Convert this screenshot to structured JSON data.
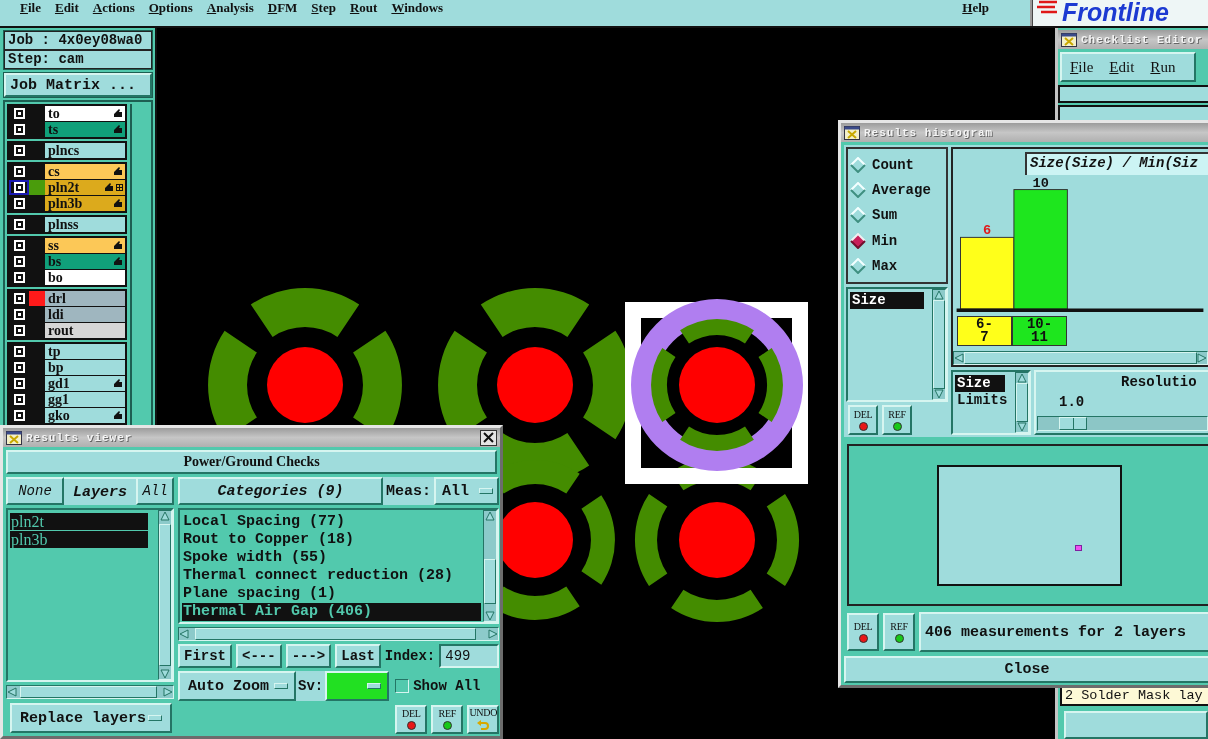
{
  "menu_bar": {
    "items": [
      "File",
      "Edit",
      "Actions",
      "Options",
      "Analysis",
      "DFM",
      "Step",
      "Rout",
      "Windows"
    ],
    "help": "Help",
    "logo": "Frontline"
  },
  "job_panel": {
    "job": "Job : 4x0ey08wa0",
    "step": "Step: cam",
    "matrix_button": "Job Matrix ..."
  },
  "layer_groups": [
    {
      "layers": [
        {
          "name": "to",
          "color": "#ffffff",
          "flagged": true,
          "grid_mark": false,
          "selected": false
        },
        {
          "name": "ts",
          "color": "#10a07a",
          "flagged": true,
          "grid_mark": false,
          "selected": false
        }
      ]
    },
    {
      "layers": [
        {
          "name": "plncs",
          "color": "#9fdcdc",
          "flagged": false,
          "grid_mark": false,
          "selected": false
        }
      ]
    },
    {
      "layers": [
        {
          "name": "cs",
          "color": "#fcc857",
          "flagged": true,
          "grid_mark": false,
          "selected": false
        },
        {
          "name": "pln2t",
          "color": "#dcaa1c",
          "swatch": {
            "color": "#4a9c0c"
          },
          "flagged": true,
          "grid_mark": true,
          "selected": true
        },
        {
          "name": "pln3b",
          "color": "#dcaa1c",
          "flagged": true,
          "grid_mark": false,
          "selected": false
        }
      ]
    },
    {
      "layers": [
        {
          "name": "plnss",
          "color": "#9fdcdc",
          "flagged": false,
          "grid_mark": false,
          "selected": false
        }
      ]
    },
    {
      "layers": [
        {
          "name": "ss",
          "color": "#fcc857",
          "flagged": true,
          "grid_mark": false,
          "selected": false
        },
        {
          "name": "bs",
          "color": "#10a07a",
          "flagged": true,
          "grid_mark": false,
          "selected": false
        },
        {
          "name": "bo",
          "color": "#ffffff",
          "flagged": false,
          "grid_mark": false,
          "selected": false
        }
      ]
    },
    {
      "layers": [
        {
          "name": "drl",
          "color": "#9fb6bf",
          "swatch": {
            "color": "#ff1a1a"
          },
          "flagged": false,
          "grid_mark": false,
          "selected": false
        },
        {
          "name": "ldi",
          "color": "#9fb6bf",
          "flagged": false,
          "grid_mark": false,
          "selected": false
        },
        {
          "name": "rout",
          "color": "#d6d6d6",
          "flagged": false,
          "grid_mark": false,
          "selected": false
        }
      ]
    },
    {
      "layers": [
        {
          "name": "tp",
          "color": "#9fdcdc",
          "flagged": false,
          "grid_mark": false,
          "selected": false
        },
        {
          "name": "bp",
          "color": "#9fdcdc",
          "flagged": false,
          "grid_mark": false,
          "selected": false
        },
        {
          "name": "gd1",
          "color": "#9fdcdc",
          "flagged": true,
          "grid_mark": false,
          "selected": false
        },
        {
          "name": "gg1",
          "color": "#9fdcdc",
          "flagged": false,
          "grid_mark": false,
          "selected": false
        },
        {
          "name": "gko",
          "color": "#9fdcdc",
          "flagged": true,
          "grid_mark": false,
          "selected": false
        }
      ]
    }
  ],
  "checklist_editor": {
    "title": "Checklist Editor",
    "menu": [
      "File",
      "Edit",
      "Run"
    ],
    "item": "2 Solder Mask lay"
  },
  "results_histogram": {
    "title": "Results histogram",
    "modes": [
      {
        "label": "Count",
        "selected": false
      },
      {
        "label": "Average",
        "selected": false
      },
      {
        "label": "Sum",
        "selected": false
      },
      {
        "label": "Min",
        "selected": true
      },
      {
        "label": "Max",
        "selected": false
      }
    ],
    "fields": [
      {
        "label": "Size",
        "selected": true
      }
    ],
    "field_buttons": [
      {
        "label": "DEL",
        "kind": "delete"
      },
      {
        "label": "REF",
        "kind": "reference"
      }
    ],
    "chart_title": "Size(Size) / Min(Siz",
    "chart_data": {
      "type": "bar",
      "categories": [
        "6-7",
        "10-11"
      ],
      "values": [
        6,
        10
      ],
      "data_labels": true
    },
    "axis_options": [
      {
        "label": "Size",
        "selected": true
      },
      {
        "label": "Limits",
        "selected": false
      }
    ],
    "resolution": {
      "label": "Resolutio",
      "reading": "1.0",
      "level": 0.15
    },
    "status_buttons": [
      {
        "label": "DEL",
        "kind": "delete"
      },
      {
        "label": "REF",
        "kind": "reference"
      }
    ],
    "status": "406 measurements for 2 layers",
    "close": "Close"
  },
  "results_viewer": {
    "title": "Results viewer",
    "header": "Power/Ground Checks",
    "none_button": "None",
    "layers_label": "Layers",
    "all_button": "All",
    "layers": [
      {
        "name": "pln2t",
        "selected": true
      },
      {
        "name": "pln3b",
        "selected": true
      }
    ],
    "replace_menu": "Replace layers",
    "categories_button": "Categories (9)",
    "meas_label": "Meas:",
    "meas_value": "All",
    "categories": [
      {
        "label": "Local Spacing (77)",
        "selected": false
      },
      {
        "label": "Rout to Copper (18)",
        "selected": false
      },
      {
        "label": "Spoke width (55)",
        "selected": false
      },
      {
        "label": "Thermal connect reduction (28)",
        "selected": false
      },
      {
        "label": "Plane spacing (1)",
        "selected": false
      },
      {
        "label": "Thermal Air Gap (406)",
        "selected": true
      }
    ],
    "nav_buttons": [
      "First",
      "<---",
      "--->",
      "Last"
    ],
    "index_label": "Index:",
    "index_value": "499",
    "zoom_menu": "Auto Zoom",
    "severity": {
      "label": "Sv:",
      "color": "#22e022"
    },
    "show_all": {
      "label": "Show All",
      "checked": false
    },
    "buttons": [
      {
        "label": "DEL",
        "kind": "delete"
      },
      {
        "label": "REF",
        "kind": "reference"
      },
      {
        "label": "UNDO",
        "kind": "undo"
      }
    ]
  }
}
